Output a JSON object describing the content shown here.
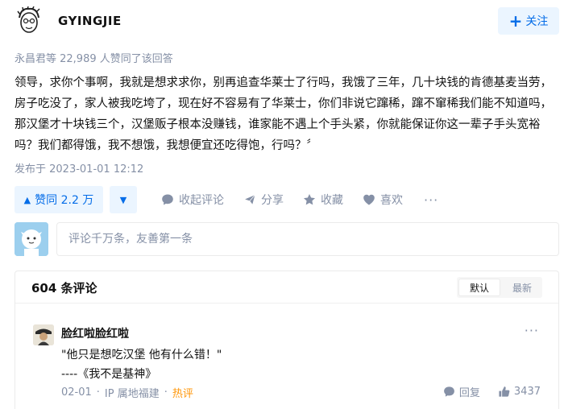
{
  "author": {
    "name": "GYINGJIE",
    "follow_label": "关注",
    "follow_icon": "plus-icon"
  },
  "answer": {
    "voters_text": "永昌君等 22,989 人赞同了该回答",
    "content": "领导，求你个事啊，我就是想求求你，别再追查华莱士了行吗，我饿了三年，几十块钱的肯德基麦当劳，房子吃没了，家人被我吃垮了，现在好不容易有了华莱士，你们非说它蹿稀，蹿不窜稀我们能不知道吗，那汉堡才十块钱三个，汉堡贩子根本没赚钱，谁家能不遇上个手头紧，你就能保证你这一辈子手头宽裕吗？我们都得饿，我不想饿，我想便宜还吃得饱，行吗？〞",
    "published": "发布于 2023-01-01 12:12"
  },
  "actions": {
    "vote_up_label": "赞同 2.2 万",
    "collapse_comments": "收起评论",
    "share": "分享",
    "favorite": "收藏",
    "like": "喜欢",
    "more": "···"
  },
  "comment_input": {
    "placeholder": "评论千万条，友善第一条"
  },
  "comments": {
    "count_label": "604 条评论",
    "sort_default": "默认",
    "sort_latest": "最新",
    "items": [
      {
        "user": "脸红啦脸红啦",
        "line1": "\"他只是想吃汉堡 他有什么错！\"",
        "line2": "----《我不是基神》",
        "date": "02-01",
        "location": "IP 属地福建",
        "tag": "热评",
        "reply_label": "回复",
        "likes": "3437",
        "more": "···"
      }
    ]
  },
  "colors": {
    "accent": "#056de8",
    "accent_bg": "#ebf5ff",
    "muted": "#8590a6",
    "hot": "#ff9607"
  }
}
